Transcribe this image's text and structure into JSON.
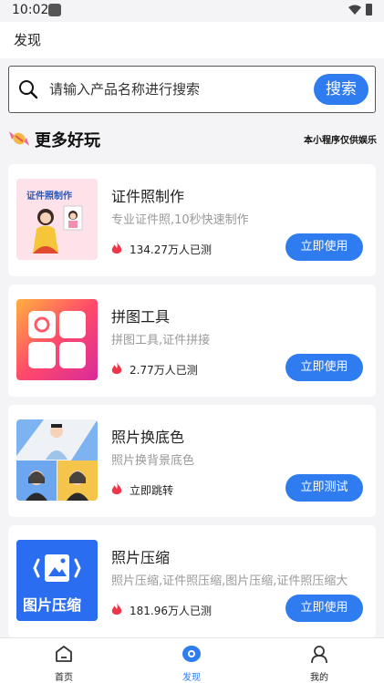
{
  "status": {
    "time": "10:02"
  },
  "header": {
    "title": "发现"
  },
  "search": {
    "placeholder": "请输入产品名称进行搜索",
    "button": "搜索"
  },
  "section": {
    "title": "更多好玩",
    "note": "本小程序仅供娱乐"
  },
  "cards": [
    {
      "name": "证件照制作",
      "desc": "专业证件照,10秒快速制作",
      "count": "134.27万人已测",
      "button": "立即使用",
      "thumb_text": "证件照制作"
    },
    {
      "name": "拼图工具",
      "desc": "拼图工具,证件拼接",
      "count": "2.77万人已测",
      "button": "立即使用"
    },
    {
      "name": "照片换底色",
      "desc": "照片换背景底色",
      "count": "立即跳转",
      "button": "立即测试"
    },
    {
      "name": "照片压缩",
      "desc": "照片压缩,证件照压缩,图片压缩,证件照压缩大",
      "count": "181.96万人已测",
      "button": "立即使用",
      "thumb_text": "图片压缩"
    }
  ],
  "tabs": [
    {
      "label": "首页",
      "icon": "home-icon"
    },
    {
      "label": "发现",
      "icon": "discover-icon",
      "active": true
    },
    {
      "label": "我的",
      "icon": "profile-icon"
    }
  ],
  "colors": {
    "accent": "#2f7bf0",
    "fire": "#f0344a"
  }
}
